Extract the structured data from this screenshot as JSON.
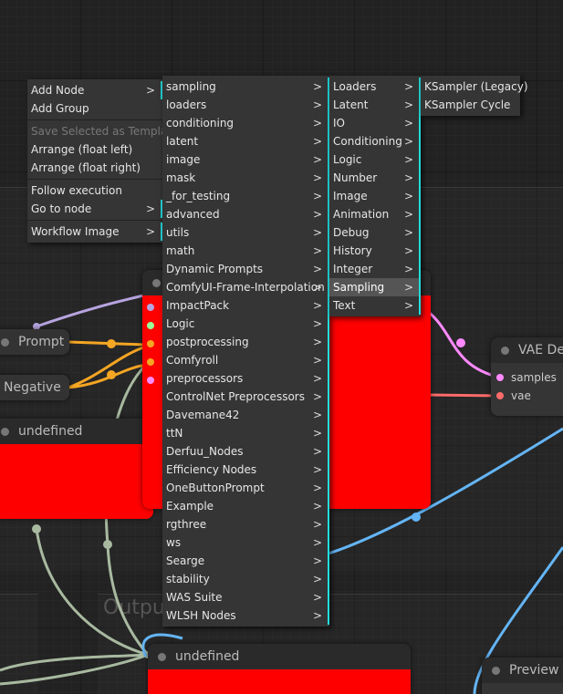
{
  "canvas": {
    "group_output_title": "Outpu"
  },
  "nodes": {
    "prompt": "Prompt",
    "negative": "Negative",
    "undefined_left": "undefined",
    "undefined_bottom": "undefined",
    "vae_decode": "VAE De",
    "vae_inputs": [
      "samples",
      "vae"
    ],
    "preview": "Preview In"
  },
  "context_menu": [
    {
      "label": "Add Node",
      "submenu": true
    },
    {
      "label": "Add Group"
    },
    {
      "separator": true
    },
    {
      "label": "Save Selected as Template",
      "disabled": true
    },
    {
      "label": "Arrange (float left)"
    },
    {
      "label": "Arrange (float right)"
    },
    {
      "separator": true
    },
    {
      "label": "Follow execution"
    },
    {
      "label": "Go to node",
      "submenu": true
    },
    {
      "separator": true
    },
    {
      "label": "Workflow Image",
      "submenu": true
    }
  ],
  "categories_menu": [
    "sampling",
    "loaders",
    "conditioning",
    "latent",
    "image",
    "mask",
    "_for_testing",
    "advanced",
    "utils",
    "math",
    "Dynamic Prompts",
    "ComfyUI-Frame-Interpolation",
    "ImpactPack",
    "Logic",
    "postprocessing",
    "Comfyroll",
    "preprocessors",
    "ControlNet Preprocessors",
    "Davemane42",
    "ttN",
    "Derfuu_Nodes",
    "Efficiency Nodes",
    "OneButtonPrompt",
    "Example",
    "rgthree",
    "ws",
    "Searge",
    "stability",
    "WAS Suite",
    "WLSH Nodes"
  ],
  "sampling_menu": [
    "Loaders",
    "Latent",
    "IO",
    "Conditioning",
    "Logic",
    "Number",
    "Image",
    "Animation",
    "Debug",
    "History",
    "Integer",
    "Sampling",
    "Text"
  ],
  "sampling_highlight": "Sampling",
  "nodes_menu": [
    "KSampler (Legacy)",
    "KSampler Cycle"
  ],
  "submenu_arrow": ">",
  "colors": {
    "accent": "#22dddd",
    "red_node": "#ff0000",
    "highlight": "#555555"
  }
}
